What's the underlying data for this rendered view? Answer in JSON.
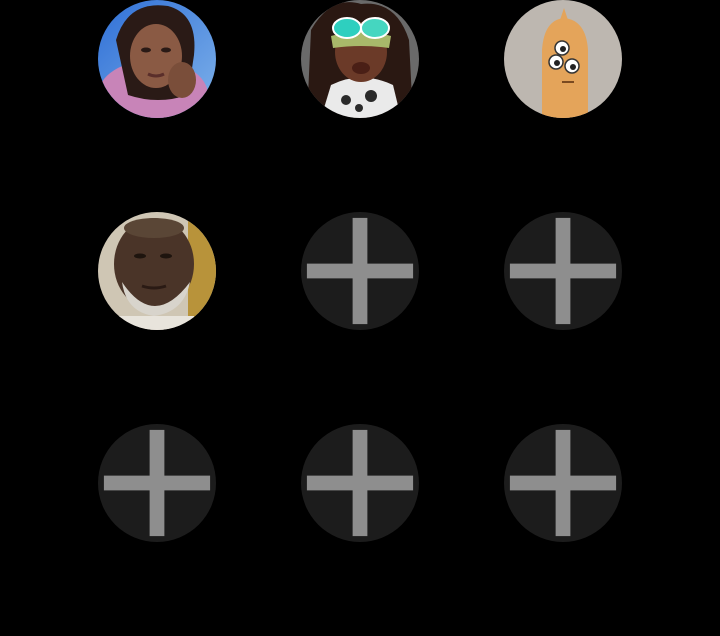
{
  "colors": {
    "background": "#000000",
    "add_slot_fill": "#1c1c1c",
    "plus_color": "#8e8e8e"
  },
  "favorites": [
    {
      "kind": "contact",
      "avatar": "photo-avatar-woman-pink-top"
    },
    {
      "kind": "contact",
      "avatar": "photo-avatar-woman-sunglasses"
    },
    {
      "kind": "contact",
      "avatar": "cartoon-avatar-three-eyes"
    },
    {
      "kind": "contact",
      "avatar": "photo-avatar-man-gray-beard"
    },
    {
      "kind": "empty",
      "icon": "plus-icon"
    },
    {
      "kind": "empty",
      "icon": "plus-icon"
    },
    {
      "kind": "empty",
      "icon": "plus-icon"
    },
    {
      "kind": "empty",
      "icon": "plus-icon"
    },
    {
      "kind": "empty",
      "icon": "plus-icon"
    }
  ]
}
